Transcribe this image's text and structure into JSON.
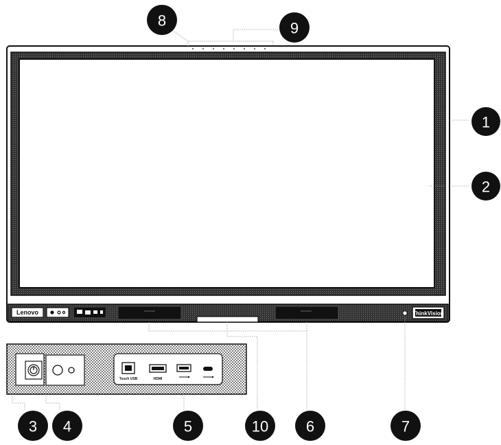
{
  "brand_left": "Lenovo",
  "brand_right": "ThinkVision",
  "callouts": {
    "c1": "1",
    "c2": "2",
    "c3": "3",
    "c4": "4",
    "c5": "5",
    "c6": "6",
    "c7": "7",
    "c8": "8",
    "c9": "9",
    "c10": "10"
  },
  "ports": {
    "touch_usb": "Touch USB",
    "hdmi": "HDMI"
  },
  "colors": {
    "frame": "#111111",
    "callout_bg": "#111111",
    "leader": "#888888"
  }
}
